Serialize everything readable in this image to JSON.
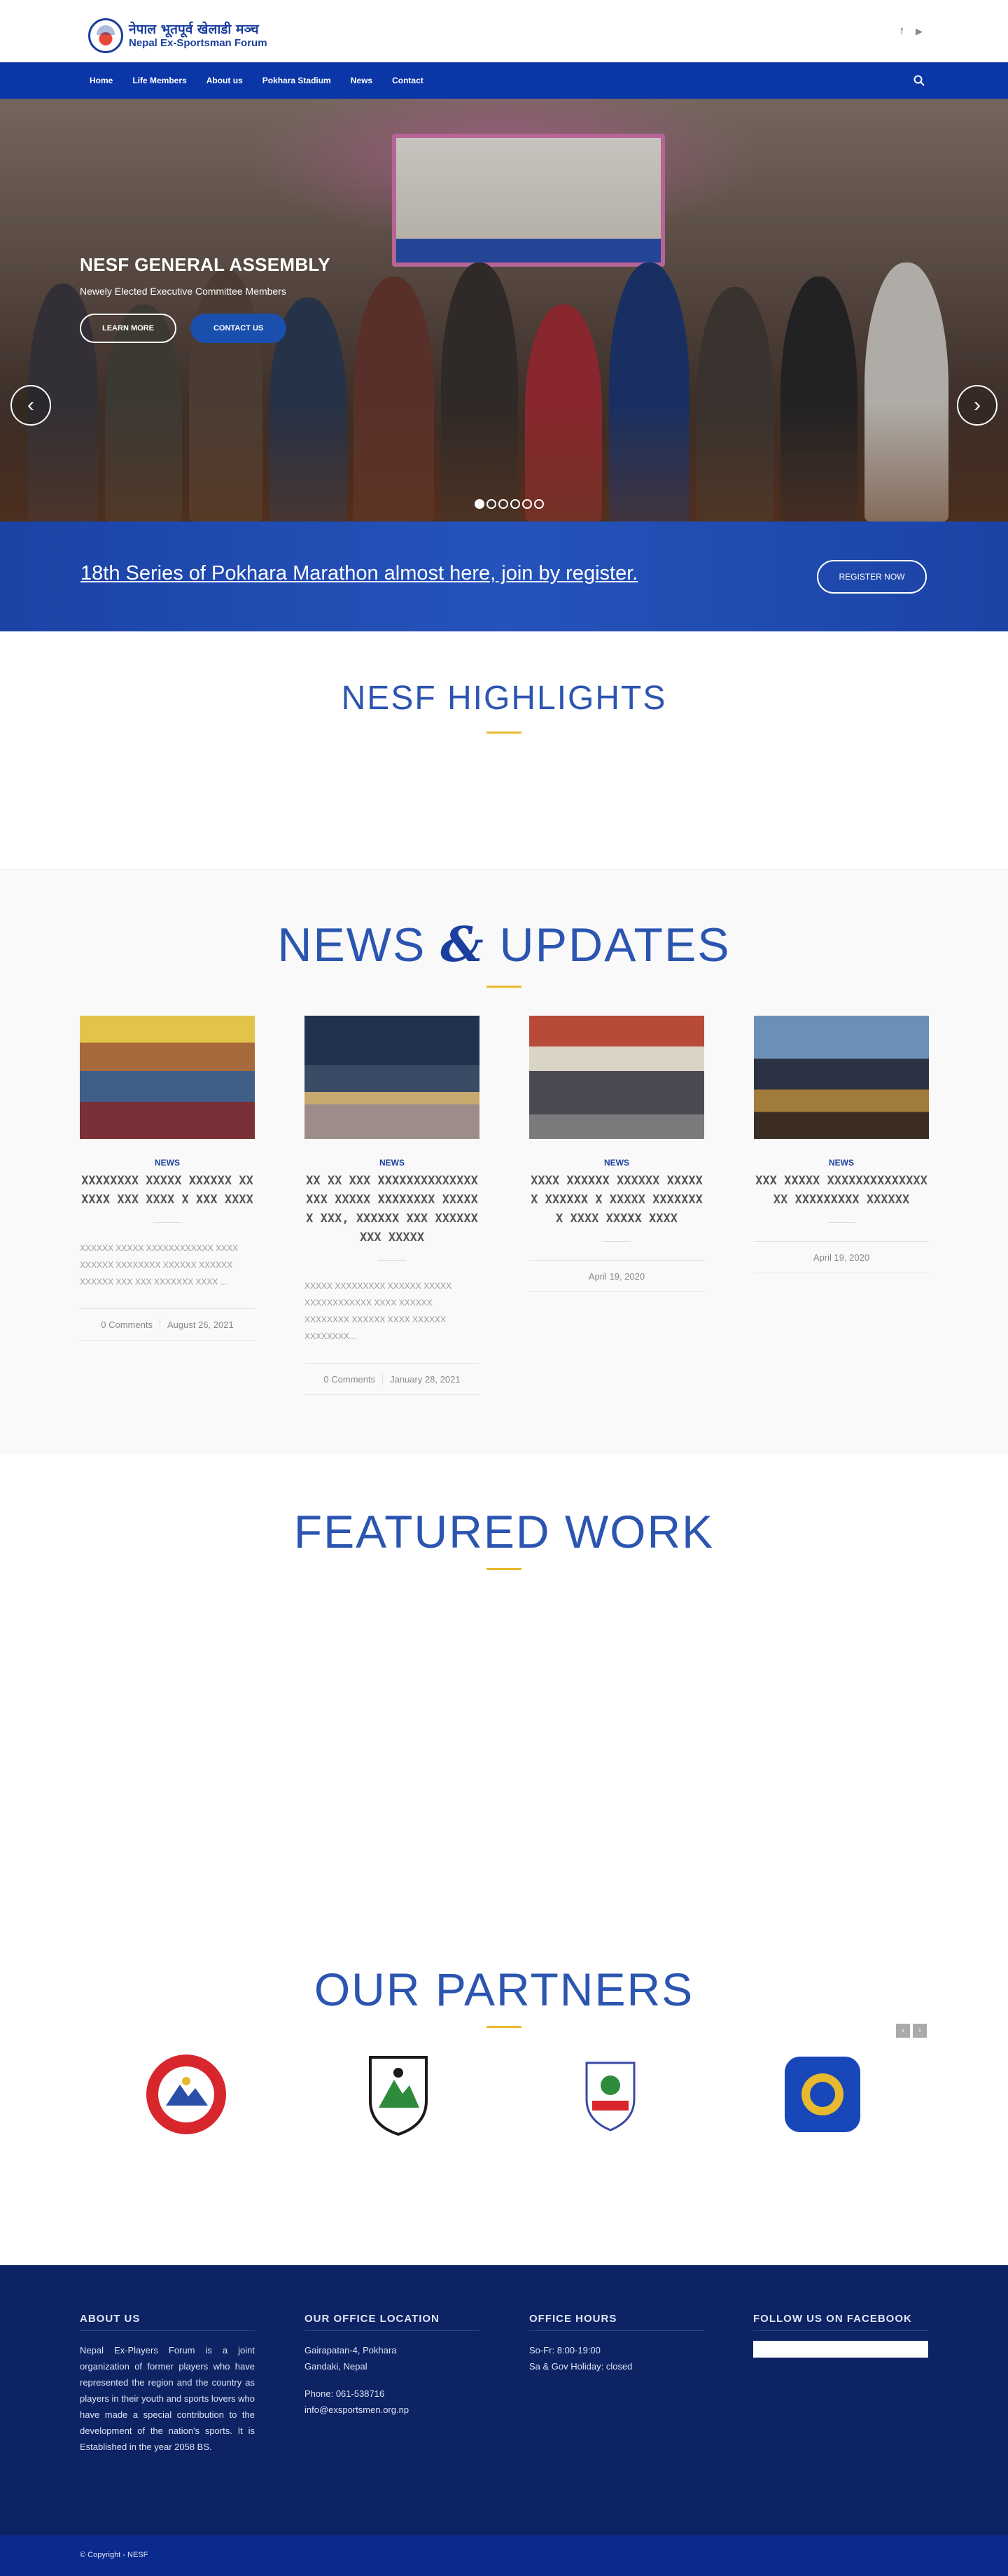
{
  "header": {
    "logo_np": "नेपाल भूतपूर्व खेलाडी मञ्च",
    "logo_en": "Nepal Ex-Sportsman Forum",
    "social": [
      "f",
      "▶"
    ]
  },
  "nav": {
    "items": [
      "Home",
      "Life Members",
      "About us",
      "Pokhara Stadium",
      "News",
      "Contact"
    ]
  },
  "hero": {
    "title": "NESF GENERAL ASSEMBLY",
    "subtitle": "Newely Elected Executive Committee Members",
    "btn_learn": "LEARN MORE",
    "btn_contact": "CONTACT US",
    "slides": 6,
    "active_slide": 0
  },
  "register": {
    "text": "18th Series of Pokhara Marathon almost here, join by register.",
    "button": "REGISTER NOW"
  },
  "highlights": {
    "title": "NESF HIGHLIGHTS"
  },
  "news": {
    "title_a": "NEWS",
    "title_amp": "&",
    "title_b": "UPDATES",
    "cards": [
      {
        "category": "NEWS",
        "heading": "ХХХХХХХХ ХХХХХ ХХХХХХ ХХХХХХ ХХХ ХХХХ Х ХХХ ХХХХ",
        "excerpt": "ХХХХХХ ХХХХХ ХХХХХХХХХХХХ ХХХХ ХХХХХХ ХХХХХХХХ ХХХХХХ ХХХХХХ ХХХХХХ ХХХ ХХХ ХХХХХХХ ХХХХ ...",
        "comments": "0 Comments",
        "date": "August 26, 2021"
      },
      {
        "category": "NEWS",
        "heading": "ХХ ХХ ХХХ ХХХХХХХХХХХХХХХХХ ХХХХХ ХХХХХХХХ ХХХХХ Х ХХХ, ХХХХХХ ХХХ ХХХХХХХХХ ХХХХХ",
        "excerpt": "ХХХХХ ХХХХХХХХХ ХХХХХХ ХХХХХ ХХХХХХХХХХХХ ХХХХ ХХХХХХ ХХХХХХХХ ХХХХХХ ХХХХ ХХХХХХ ХХХХХХХХ...",
        "comments": "0 Comments",
        "date": "January 28, 2021"
      },
      {
        "category": "NEWS",
        "heading": "ХХХХ ХХХХХХ ХХХХХХ ХХХХХХ ХХХХХХ Х ХХХХХ ХХХХХХХХ ХХХХ ХХХХХ ХХХХ",
        "excerpt": "",
        "comments": "",
        "date": "April 19, 2020"
      },
      {
        "category": "NEWS",
        "heading": "ХХХ ХХХХХ ХХХХХХХХХХХХХХХХ ХХХХХХХХХ ХХХХХХ",
        "excerpt": "",
        "comments": "",
        "date": "April 19, 2020"
      }
    ]
  },
  "featured": {
    "title": "FEATURED WORK"
  },
  "partners": {
    "title": "OUR PARTNERS",
    "prev": "‹",
    "next": "›"
  },
  "footer": {
    "about_title": "ABOUT US",
    "about_text": "Nepal Ex-Players Forum is a joint organization of former players who have represented the region and the country as players in their youth and sports lovers who have made a special contribution to the development of the nation's sports. It is Established in the year 2058 BS.",
    "office_title": "OUR OFFICE LOCATION",
    "office_line1": "Gairapatan-4, Pokhara",
    "office_line2": "Gandaki, Nepal",
    "office_phone": "Phone: 061-538716",
    "office_email": "info@exsportsmen.org.np",
    "hours_title": "OFFICE HOURS",
    "hours_line1": "So-Fr: 8:00-19:00",
    "hours_line2": "Sa & Gov Holiday: closed",
    "fb_title": "FOLLOW US ON FACEBOOK",
    "copyright": "© Copyright - NESF"
  },
  "colors": {
    "brand_blue": "#0b36a8",
    "accent_gold": "#e6b92e",
    "footer_navy": "#0d2363"
  }
}
